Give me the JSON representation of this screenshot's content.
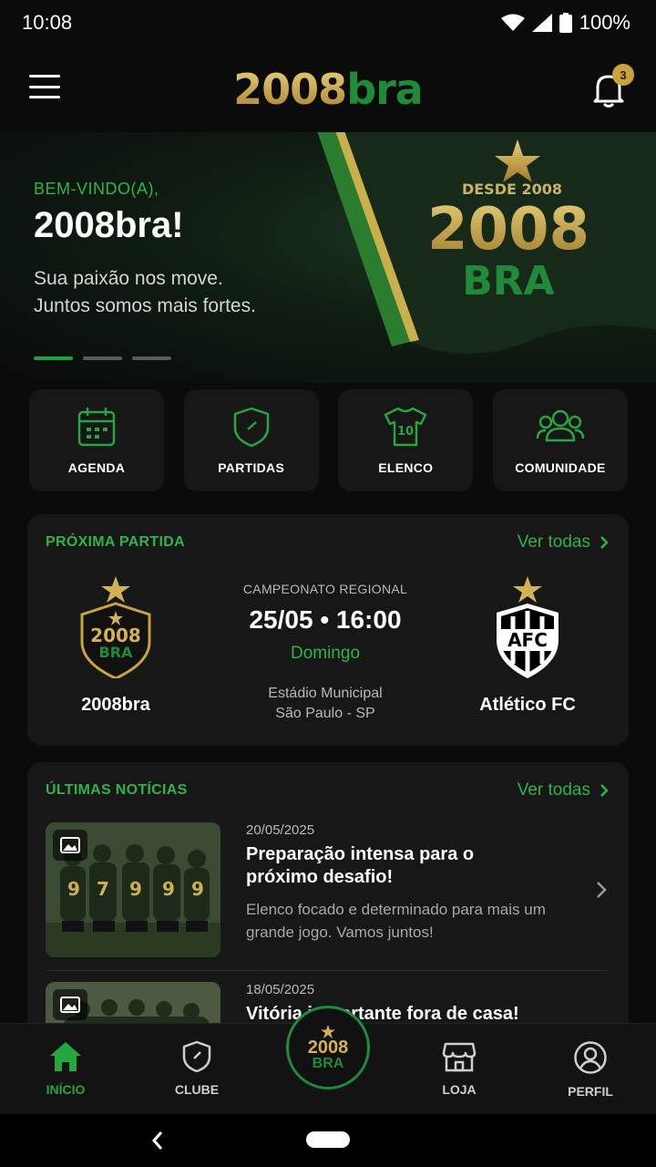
{
  "status_bar": {
    "time": "10:08",
    "battery": "100%"
  },
  "header": {
    "logo_part1": "2008",
    "logo_part2": "bra",
    "notification_count": "3"
  },
  "hero": {
    "welcome": "BEM-VINDO(A),",
    "title": "2008bra!",
    "subtitle_line1": "Sua paixão nos move.",
    "subtitle_line2": "Juntos somos mais fortes.",
    "flag_since": "DESDE 2008",
    "flag_year": "2008",
    "flag_bra": "BRA",
    "active_slide": 1,
    "slides_count": 3
  },
  "quick_actions": [
    {
      "label": "AGENDA",
      "icon": "calendar-icon"
    },
    {
      "label": "PARTIDAS",
      "icon": "shield-icon"
    },
    {
      "label": "ELENCO",
      "icon": "jersey-icon"
    },
    {
      "label": "COMUNIDADE",
      "icon": "community-icon"
    }
  ],
  "next_match": {
    "section_title": "PRÓXIMA PARTIDA",
    "see_all": "Ver todas",
    "home_team": "2008bra",
    "home_crest_year": "2008",
    "home_crest_bra": "BRA",
    "away_team": "Atlético FC",
    "away_crest": "AFC",
    "competition": "CAMPEONATO REGIONAL",
    "datetime": "25/05 • 16:00",
    "weekday": "Domingo",
    "venue_line1": "Estádio Municipal",
    "venue_line2": "São Paulo - SP"
  },
  "news": {
    "section_title": "ÚLTIMAS NOTÍCIAS",
    "see_all": "Ver todas",
    "items": [
      {
        "date": "20/05/2025",
        "title": "Preparação intensa para o próximo desafio!",
        "description": "Elenco focado e determinado para mais um grande jogo. Vamos juntos!"
      },
      {
        "date": "18/05/2025",
        "title": "Vitória importante fora de casa!",
        "description": ""
      }
    ]
  },
  "tabs": [
    {
      "label": "INÍCIO",
      "icon": "home-icon",
      "active": true
    },
    {
      "label": "CLUBE",
      "icon": "shield-icon",
      "active": false
    },
    {
      "label": "LOJA",
      "icon": "store-icon",
      "active": false
    },
    {
      "label": "PERFIL",
      "icon": "profile-icon",
      "active": false
    }
  ],
  "center_button": {
    "year": "2008",
    "bra": "BRA"
  },
  "colors": {
    "accent_green": "#1fa33f",
    "gold": "#c9a43b",
    "background": "#0b0b0b",
    "card": "#161716"
  }
}
